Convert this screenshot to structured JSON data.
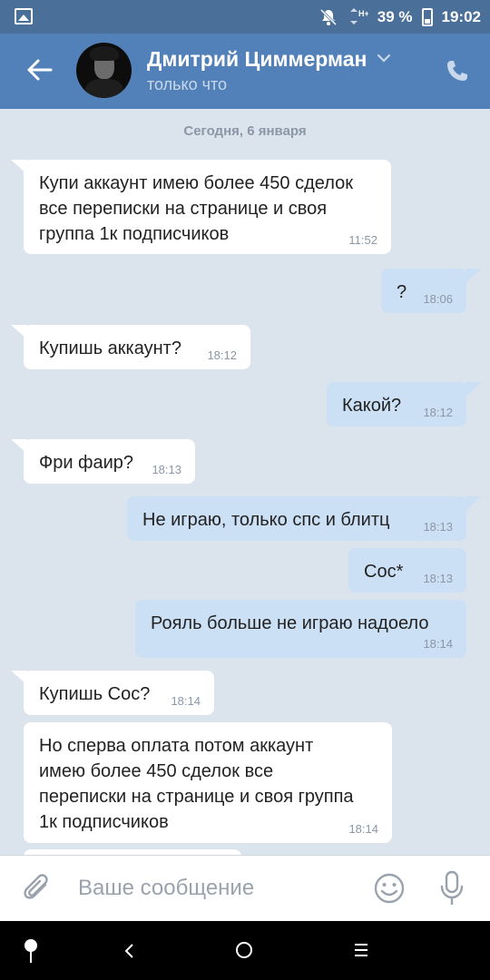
{
  "status_bar": {
    "battery": "39 %",
    "time": "19:02",
    "network": "H+",
    "icons": [
      "image-icon",
      "mute-icon",
      "signal-icon",
      "battery-icon"
    ]
  },
  "header": {
    "contact_name": "Дмитрий Циммерман",
    "status": "только что",
    "icons": [
      "back-arrow-icon",
      "chevron-down-icon",
      "phone-icon"
    ]
  },
  "chat": {
    "date": "Сегодня, 6 января",
    "messages": [
      {
        "dir": "in",
        "text": "Купи аккаунт имею более 450 сделок\nвсе переписки на странице и своя\nгруппа 1к подписчиков",
        "time": "11:52"
      },
      {
        "dir": "out",
        "text": "?",
        "time": "18:06"
      },
      {
        "dir": "in",
        "text": "Купишь аккаунт?",
        "time": "18:12"
      },
      {
        "dir": "out",
        "text": "Какой?",
        "time": "18:12"
      },
      {
        "dir": "in",
        "text": "Фри фаир?",
        "time": "18:13"
      },
      {
        "dir": "out",
        "text": "Не играю, только спс и блитц",
        "time": "18:13"
      },
      {
        "dir": "out",
        "text": "Сос*",
        "time": "18:13"
      },
      {
        "dir": "out",
        "text": "Рояль больше  не играю надоело",
        "time": "18:14"
      },
      {
        "dir": "in",
        "text": "Купишь Сос?",
        "time": "18:14"
      },
      {
        "dir": "in",
        "text": "Но сперва оплата потом аккаунт\nимею более 450 сделок все\nпереписки на странице и своя группа\n1к подписчиков",
        "time": "18:14"
      }
    ]
  },
  "input": {
    "placeholder": "Ваше сообщение",
    "value": "",
    "icons": [
      "paperclip-icon",
      "smile-icon",
      "microphone-icon"
    ]
  },
  "colors": {
    "header": "#5181b8",
    "status_bar": "#4a6f99",
    "chat_bg": "#dbe3ec",
    "incoming_bubble": "#ffffff",
    "outgoing_bubble": "#cce0f5",
    "timestamp": "#8b97a6"
  },
  "nav_bar": {
    "icons": [
      "location-pin-icon",
      "nav-back-icon",
      "nav-home-icon",
      "nav-menu-icon"
    ]
  }
}
